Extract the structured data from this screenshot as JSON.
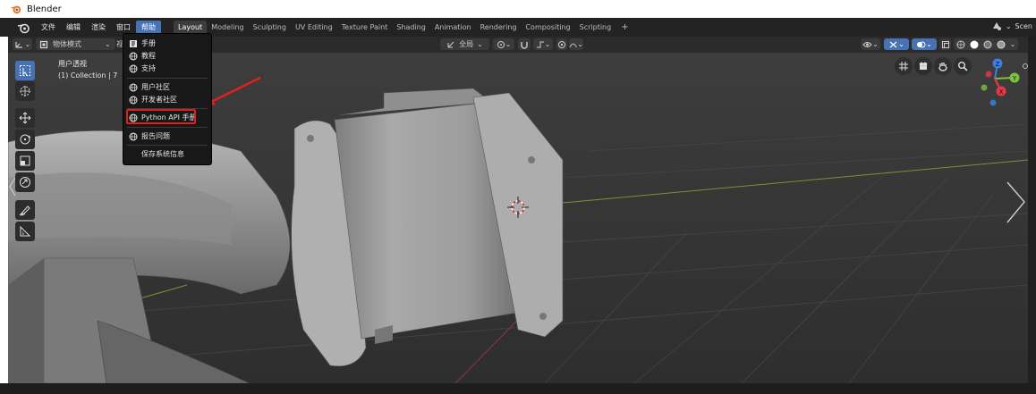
{
  "window": {
    "title": "Blender"
  },
  "menu": {
    "items": [
      "文件",
      "编辑",
      "渲染",
      "窗口",
      "帮助"
    ],
    "active_index": 4
  },
  "workspaces": {
    "tabs": [
      "Layout",
      "Modeling",
      "Sculpting",
      "UV Editing",
      "Texture Paint",
      "Shading",
      "Animation",
      "Rendering",
      "Compositing",
      "Scripting"
    ],
    "active_index": 0,
    "add_label": "+"
  },
  "scene_label": "Scen",
  "header": {
    "mode_label": "物体模式",
    "view_label": "视",
    "transform_global": "全局"
  },
  "viewport": {
    "overlay_line1": "用户透视",
    "overlay_line2": "(1) Collection | 7",
    "gizmo": {
      "x_label": "X",
      "y_label": "Y",
      "z_label": "Z"
    }
  },
  "help_menu": {
    "items": [
      {
        "label": "手册",
        "icon": "manual-icon"
      },
      {
        "label": "教程",
        "icon": "globe-icon"
      },
      {
        "label": "支持",
        "icon": "globe-icon"
      },
      {
        "label": "用户社区",
        "icon": "globe-icon"
      },
      {
        "label": "开发者社区",
        "icon": "globe-icon"
      },
      {
        "label": "Python API 手册",
        "icon": "globe-icon",
        "highlighted": true
      },
      {
        "label": "报告问题",
        "icon": "globe-icon"
      },
      {
        "label": "保存系统信息",
        "icon": ""
      }
    ]
  },
  "colors": {
    "accent": "#4772b3",
    "annotation": "#e0201b",
    "axis_x": "#e6384a",
    "axis_y": "#7dc23c",
    "axis_z": "#3d7fe6"
  }
}
